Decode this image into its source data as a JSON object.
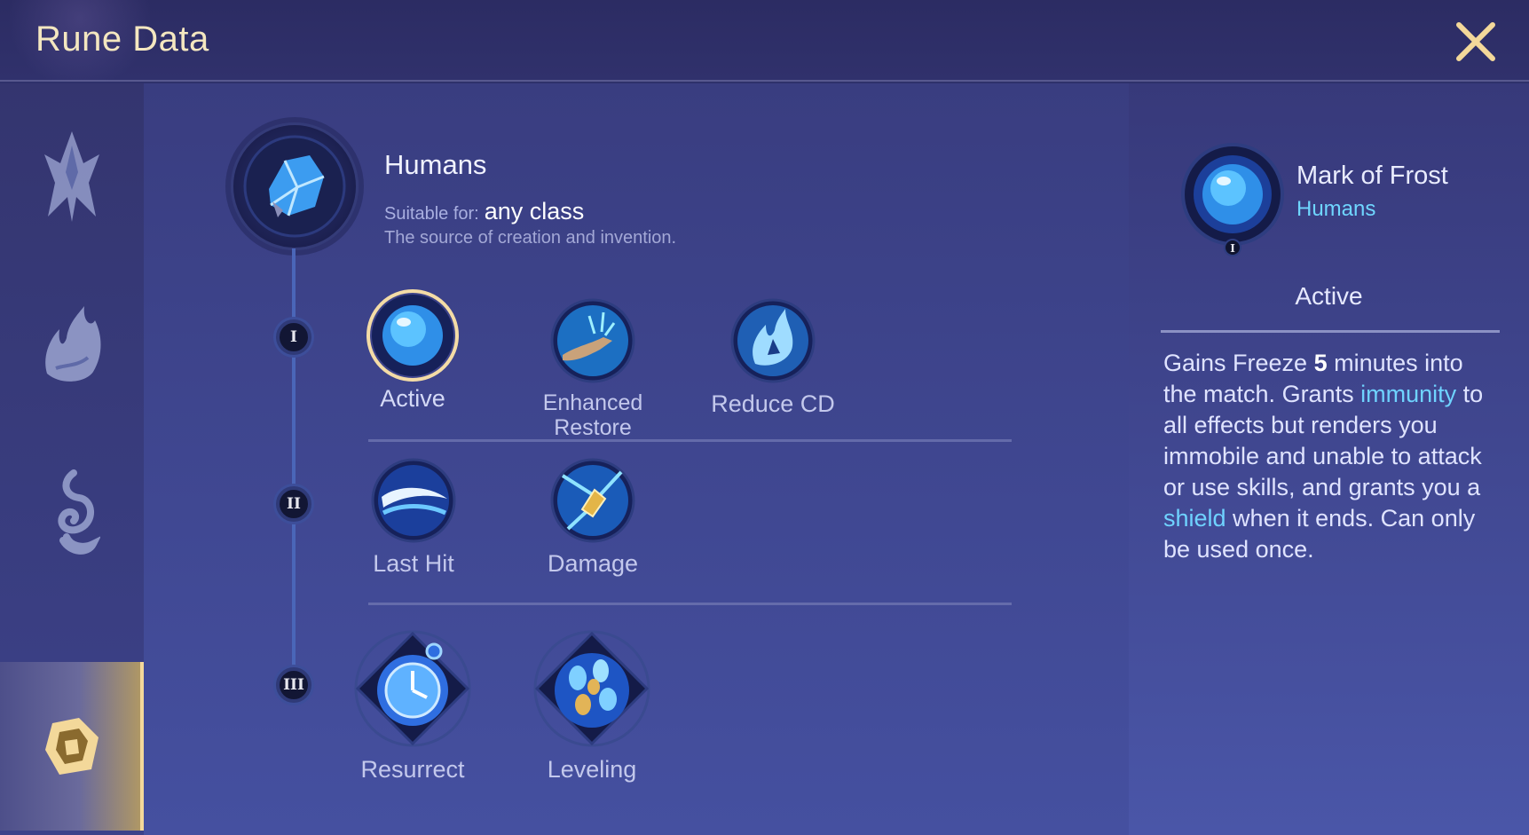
{
  "header": {
    "title": "Rune Data",
    "close_icon": "close-icon"
  },
  "sidebar": {
    "categories": [
      {
        "icon": "spiky-crest-icon",
        "selected": false
      },
      {
        "icon": "flame-claw-icon",
        "selected": false
      },
      {
        "icon": "spirit-swirl-icon",
        "selected": false
      },
      {
        "icon": "crystal-emblem-icon",
        "selected": true
      }
    ]
  },
  "race": {
    "name": "Humans",
    "suitable_label": "Suitable for:",
    "suitable_value": "any class",
    "description": "The source of creation and invention.",
    "emblem_icon": "blue-crystal-icon"
  },
  "tiers": [
    {
      "numeral": "I",
      "runes": [
        {
          "label": "Active",
          "icon": "frost-orb-icon",
          "selected": true
        },
        {
          "label": "Enhanced\nRestore",
          "icon": "healing-hand-icon",
          "selected": false
        },
        {
          "label": "Reduce CD",
          "icon": "blue-flame-icon",
          "selected": false
        }
      ]
    },
    {
      "numeral": "II",
      "runes": [
        {
          "label": "Last Hit",
          "icon": "crescent-slash-icon",
          "selected": false
        },
        {
          "label": "Damage",
          "icon": "gold-shard-icon",
          "selected": false
        }
      ]
    },
    {
      "numeral": "III",
      "runes": [
        {
          "label": "Resurrect",
          "icon": "stopwatch-icon",
          "selected": false
        },
        {
          "label": "Leveling",
          "icon": "coins-icon",
          "selected": false
        }
      ]
    }
  ],
  "detail": {
    "name": "Mark of Frost",
    "race": "Humans",
    "tier_numeral": "I",
    "tier_label": "Active",
    "desc_1": "Gains Freeze ",
    "desc_num": "5",
    "desc_2": " minutes into the match. Grants ",
    "desc_kw1": "immunity",
    "desc_3": " to all effects but renders you immobile and unable to attack or use skills, and grants you a ",
    "desc_kw2": "shield",
    "desc_4": " when it ends. Can only be used once."
  },
  "colors": {
    "accent_gold": "#f3d89a",
    "keyword_cyan": "#6fd3ff",
    "title_gold": "#f4e7c0"
  }
}
